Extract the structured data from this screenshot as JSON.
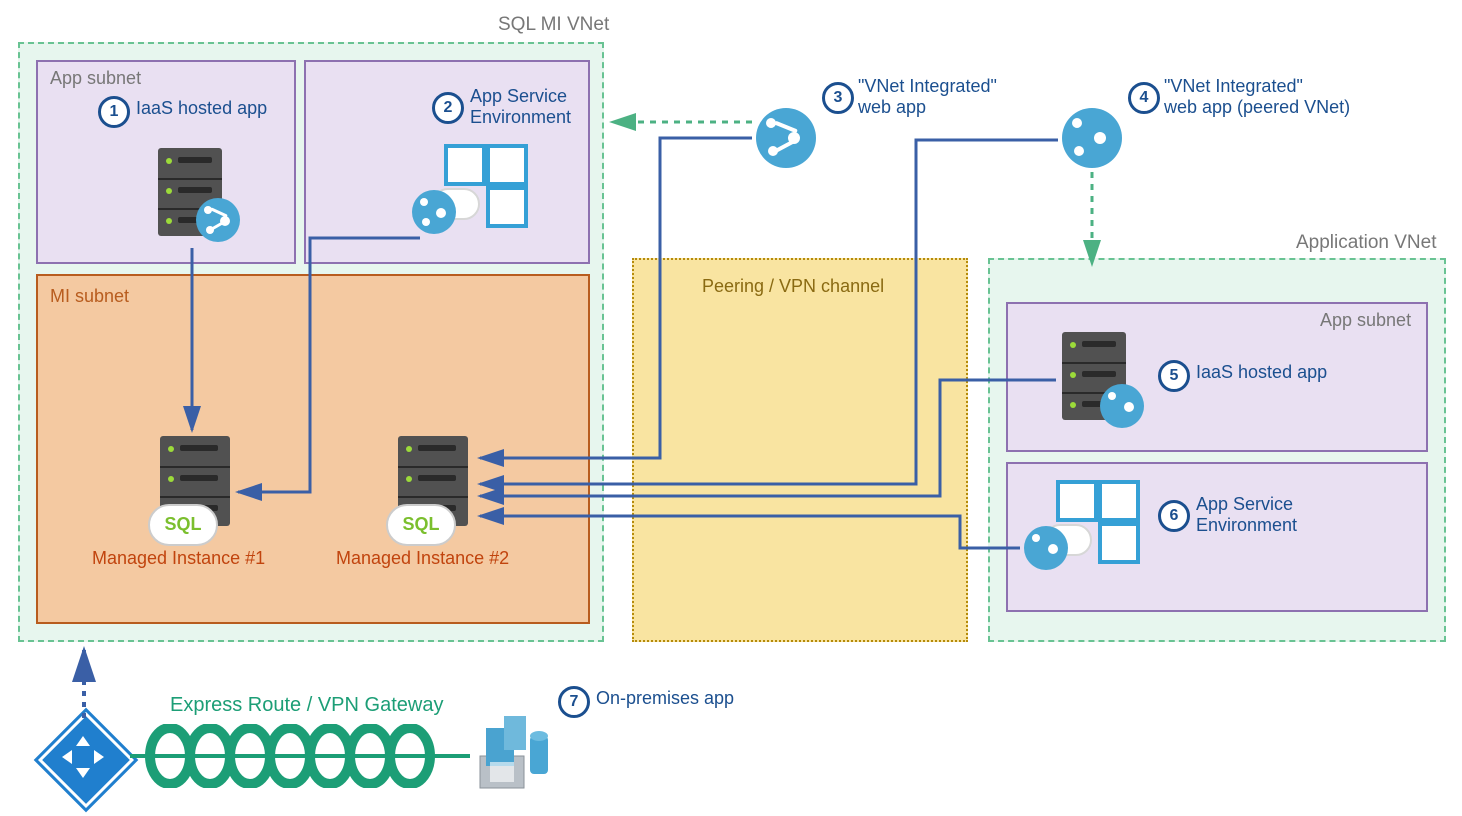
{
  "title_sql_vnet": "SQL MI VNet",
  "title_app_vnet": "Application VNet",
  "sql_vnet": {
    "app_subnet_label": "App subnet",
    "mi_subnet_label": "MI subnet",
    "item1": {
      "num": "1",
      "label": "IaaS hosted app"
    },
    "item2": {
      "num": "2",
      "label": "App Service\nEnvironment"
    },
    "mi1_label": "Managed Instance #1",
    "mi2_label": "Managed Instance #2"
  },
  "top_items": {
    "item3": {
      "num": "3",
      "label": "\"VNet Integrated\"\nweb app"
    },
    "item4": {
      "num": "4",
      "label": "\"VNet Integrated\"\nweb app (peered VNet)"
    }
  },
  "peering_label": "Peering / VPN channel",
  "app_vnet": {
    "app_subnet_label": "App subnet",
    "item5": {
      "num": "5",
      "label": "IaaS hosted app"
    },
    "item6": {
      "num": "6",
      "label": "App Service\nEnvironment"
    }
  },
  "bottom": {
    "expressroute_label": "Express Route / VPN Gateway",
    "item7": {
      "num": "7",
      "label": "On-premises app"
    }
  },
  "colors": {
    "blue": "#1b4f8f",
    "connector": "#3a5fa6",
    "green": "#69c393",
    "orange_border": "#b85c1e"
  }
}
